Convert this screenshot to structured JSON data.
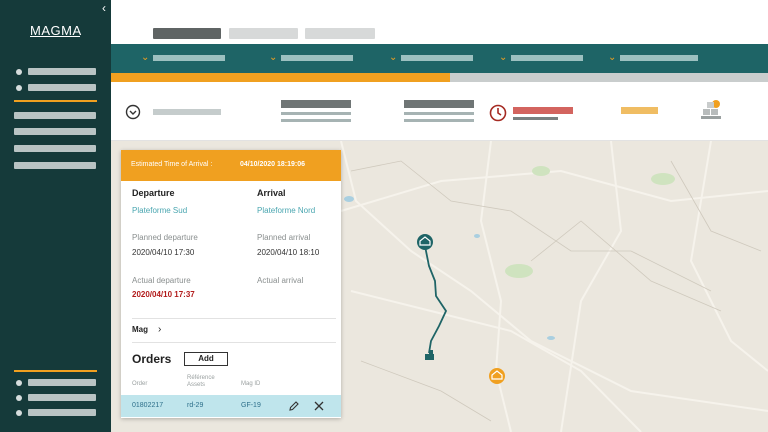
{
  "app": {
    "logo": "MAGMA"
  },
  "sidebar": {
    "collapse_icon": "chevron-left-icon"
  },
  "card": {
    "eta_label": "Estimated Time of Arrival :",
    "eta_value": "04/10/2020 18:19:06",
    "departure_heading": "Departure",
    "departure_place": "Plateforme Sud",
    "arrival_heading": "Arrival",
    "arrival_place": "Plateforme Nord",
    "planned_departure_label": "Planned departure",
    "planned_departure_value": "2020/04/10 17:30",
    "planned_arrival_label": "Planned arrival",
    "planned_arrival_value": "2020/04/10 18:10",
    "actual_departure_label": "Actual departure",
    "actual_departure_value": "2020/04/10 17:37",
    "actual_arrival_label": "Actual arrival",
    "mag_label": "Mag",
    "orders_title": "Orders",
    "add_label": "Add",
    "columns": {
      "order": "Order",
      "reference": "Référence Assets",
      "mag_id": "Mag ID"
    },
    "row": {
      "order": "01802217",
      "reference": "rd-29",
      "mag_id": "GF-19"
    }
  },
  "colors": {
    "sidebar": "#153a3a",
    "nav": "#1e6466",
    "accent": "#f0a020",
    "late": "#b21c1c"
  }
}
